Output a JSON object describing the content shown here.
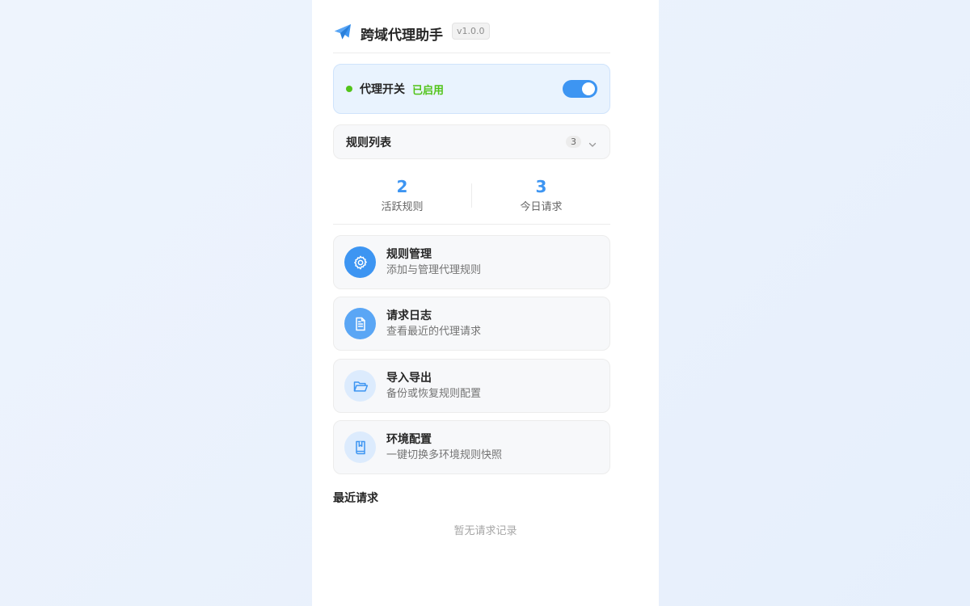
{
  "app": {
    "title": "跨域代理助手",
    "version": "v1.0.0",
    "logo_icon": "paper-plane-icon",
    "accent_color": "#3d95f2"
  },
  "proxy": {
    "label": "代理开关",
    "state": "已启用",
    "enabled": true,
    "status_color": "#52c41a"
  },
  "rules_list": {
    "title": "规则列表",
    "count": "3",
    "icon": "chevron-down-icon"
  },
  "stats": [
    {
      "value": "2",
      "label": "活跃规则"
    },
    {
      "value": "3",
      "label": "今日请求"
    }
  ],
  "menu": [
    {
      "title": "规则管理",
      "desc": "添加与管理代理规则",
      "icon": "gear-icon"
    },
    {
      "title": "请求日志",
      "desc": "查看最近的代理请求",
      "icon": "document-icon"
    },
    {
      "title": "导入导出",
      "desc": "备份或恢复规则配置",
      "icon": "folder-open-icon"
    },
    {
      "title": "环境配置",
      "desc": "一键切换多环境规则快照",
      "icon": "book-icon"
    }
  ],
  "recent": {
    "title": "最近请求",
    "empty": "暂无请求记录"
  }
}
